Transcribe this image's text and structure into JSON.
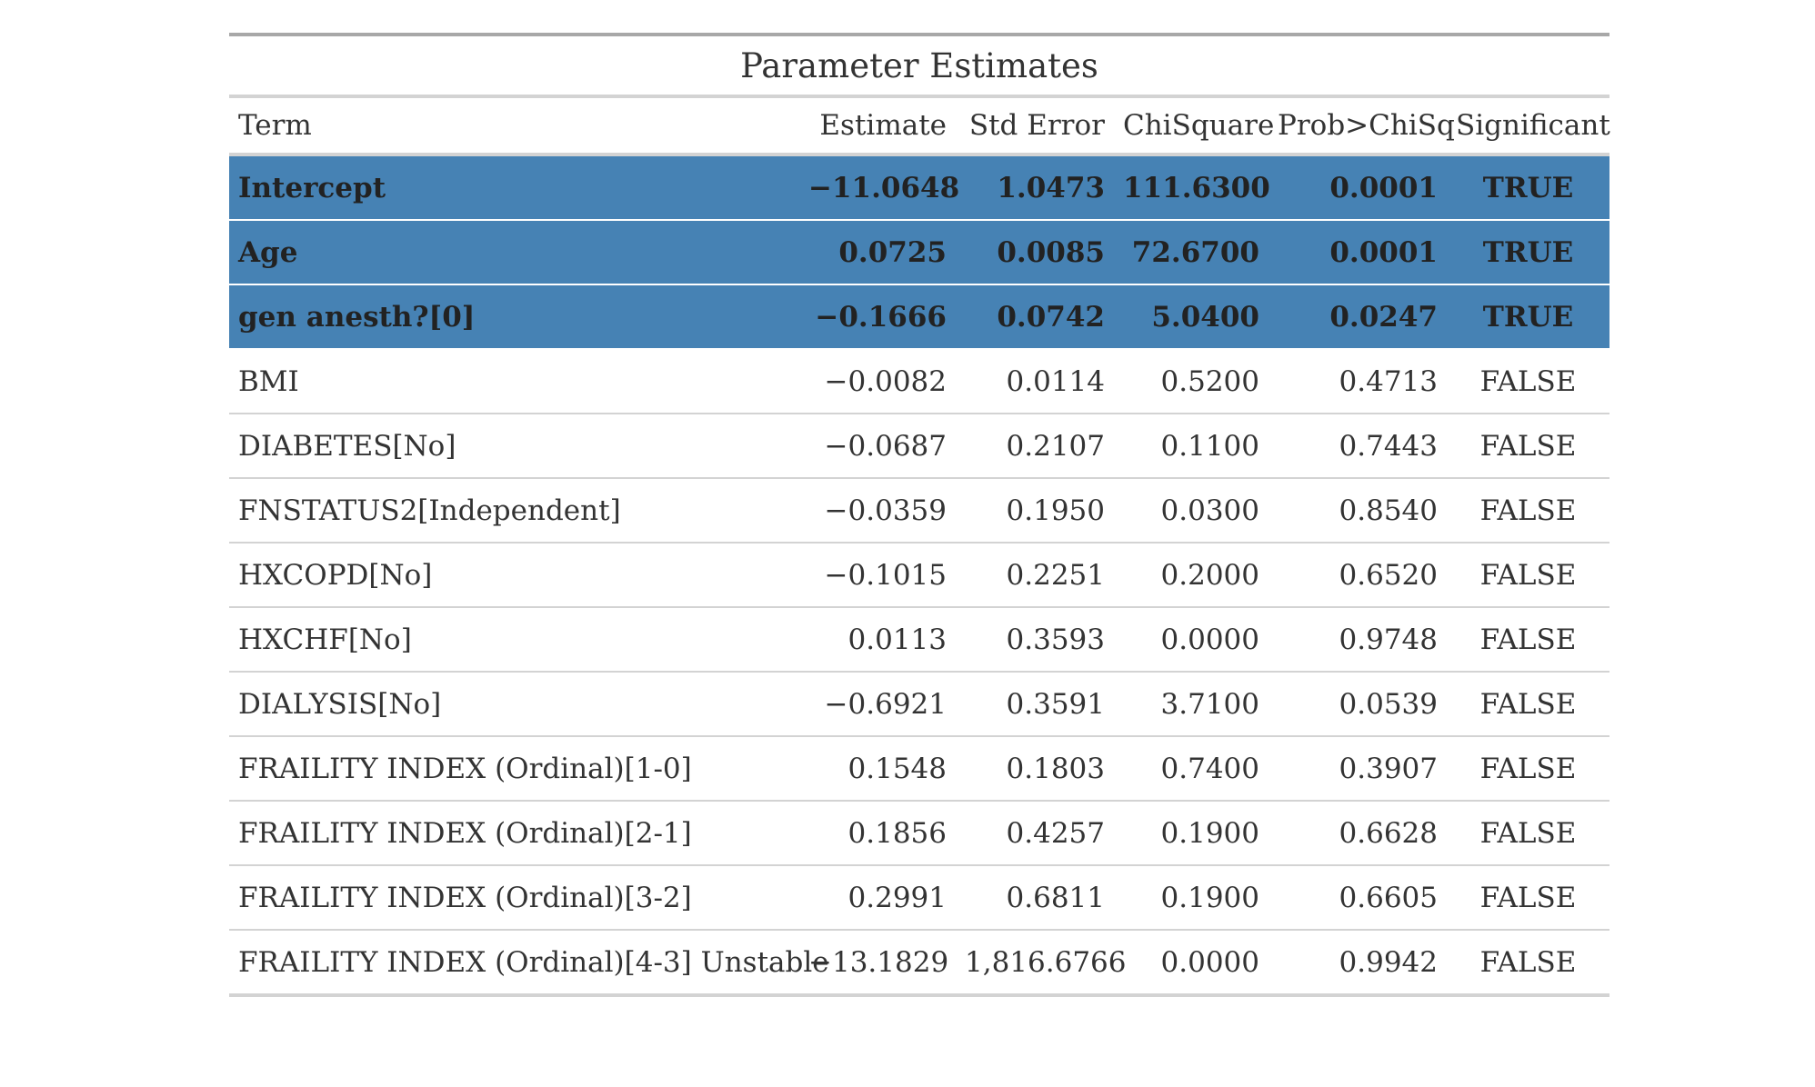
{
  "table": {
    "title": "Parameter Estimates",
    "columns": [
      "Term",
      "Estimate",
      "Std Error",
      "ChiSquare",
      "Prob>ChiSq",
      "Significant"
    ],
    "highlight_color": "#4682b4",
    "rows": [
      {
        "term": "Intercept",
        "estimate": "−11.0648",
        "std_error": "1.0473",
        "chisquare": "111.6300",
        "prob": "0.0001",
        "significant": "TRUE"
      },
      {
        "term": "Age",
        "estimate": "0.0725",
        "std_error": "0.0085",
        "chisquare": "72.6700",
        "prob": "0.0001",
        "significant": "TRUE"
      },
      {
        "term": "gen anesth?[0]",
        "estimate": "−0.1666",
        "std_error": "0.0742",
        "chisquare": "5.0400",
        "prob": "0.0247",
        "significant": "TRUE"
      },
      {
        "term": "BMI",
        "estimate": "−0.0082",
        "std_error": "0.0114",
        "chisquare": "0.5200",
        "prob": "0.4713",
        "significant": "FALSE"
      },
      {
        "term": "DIABETES[No]",
        "estimate": "−0.0687",
        "std_error": "0.2107",
        "chisquare": "0.1100",
        "prob": "0.7443",
        "significant": "FALSE"
      },
      {
        "term": "FNSTATUS2[Independent]",
        "estimate": "−0.0359",
        "std_error": "0.1950",
        "chisquare": "0.0300",
        "prob": "0.8540",
        "significant": "FALSE"
      },
      {
        "term": "HXCOPD[No]",
        "estimate": "−0.1015",
        "std_error": "0.2251",
        "chisquare": "0.2000",
        "prob": "0.6520",
        "significant": "FALSE"
      },
      {
        "term": "HXCHF[No]",
        "estimate": "0.0113",
        "std_error": "0.3593",
        "chisquare": "0.0000",
        "prob": "0.9748",
        "significant": "FALSE"
      },
      {
        "term": "DIALYSIS[No]",
        "estimate": "−0.6921",
        "std_error": "0.3591",
        "chisquare": "3.7100",
        "prob": "0.0539",
        "significant": "FALSE"
      },
      {
        "term": "FRAILITY INDEX (Ordinal)[1-0]",
        "estimate": "0.1548",
        "std_error": "0.1803",
        "chisquare": "0.7400",
        "prob": "0.3907",
        "significant": "FALSE"
      },
      {
        "term": "FRAILITY INDEX (Ordinal)[2-1]",
        "estimate": "0.1856",
        "std_error": "0.4257",
        "chisquare": "0.1900",
        "prob": "0.6628",
        "significant": "FALSE"
      },
      {
        "term": "FRAILITY INDEX (Ordinal)[3-2]",
        "estimate": "0.2991",
        "std_error": "0.6811",
        "chisquare": "0.1900",
        "prob": "0.6605",
        "significant": "FALSE"
      },
      {
        "term": "FRAILITY INDEX (Ordinal)[4-3] Unstable",
        "estimate": "−13.1829",
        "std_error": "1,816.6766",
        "chisquare": "0.0000",
        "prob": "0.9942",
        "significant": "FALSE"
      }
    ]
  }
}
